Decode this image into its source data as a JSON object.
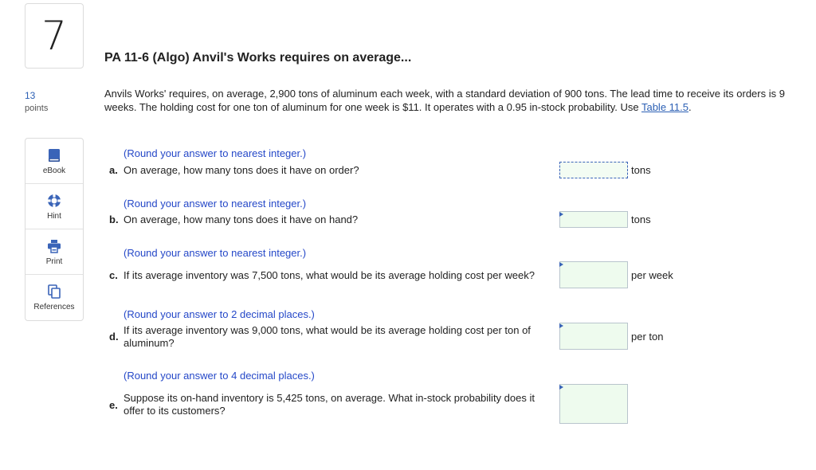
{
  "question": {
    "number": "7",
    "title": "PA 11-6 (Algo) Anvil's Works requires on average...",
    "points_value": "13",
    "points_label": "points",
    "stem_text": "Anvils Works' requires, on average, 2,900 tons of aluminum each week, with a standard deviation of 900 tons. The lead time to receive its orders is 9 weeks. The holding cost for one ton of aluminum for one week is $11. It operates with a 0.95 in-stock probability. Use ",
    "stem_link": "Table 11.5",
    "stem_end": "."
  },
  "toolbar": {
    "ebook": {
      "label": "eBook",
      "icon": "book-icon"
    },
    "hint": {
      "label": "Hint",
      "icon": "lifebuoy-icon"
    },
    "print": {
      "label": "Print",
      "icon": "printer-icon"
    },
    "references": {
      "label": "References",
      "icon": "copy-pages-icon"
    }
  },
  "parts": [
    {
      "letter": "a.",
      "instruction": "(Round your answer to nearest integer.)",
      "text": "On average, how many tons does it have on order?",
      "unit": "tons",
      "value": ""
    },
    {
      "letter": "b.",
      "instruction": "(Round your answer to nearest integer.)",
      "text": "On average, how many tons does it have on hand?",
      "unit": "tons",
      "value": ""
    },
    {
      "letter": "c.",
      "instruction": "(Round your answer to nearest integer.)",
      "text": "If its average inventory was 7,500 tons, what would be its average holding cost per week?",
      "unit": "per week",
      "value": ""
    },
    {
      "letter": "d.",
      "instruction": "(Round your answer to 2 decimal places.)",
      "text": "If its average inventory was 9,000 tons, what would be its average holding cost per ton of aluminum?",
      "unit": "per ton",
      "value": ""
    },
    {
      "letter": "e.",
      "instruction": "(Round your answer to 4 decimal places.)",
      "text": "Suppose its on-hand inventory is 5,425 tons, on average. What in-stock probability does it offer to its customers?",
      "unit": "",
      "value": ""
    }
  ],
  "colors": {
    "link": "#2b5fb4",
    "instruction": "#2548c8",
    "answer_bg": "#eefbee",
    "icon_blue": "#3a64b8"
  }
}
